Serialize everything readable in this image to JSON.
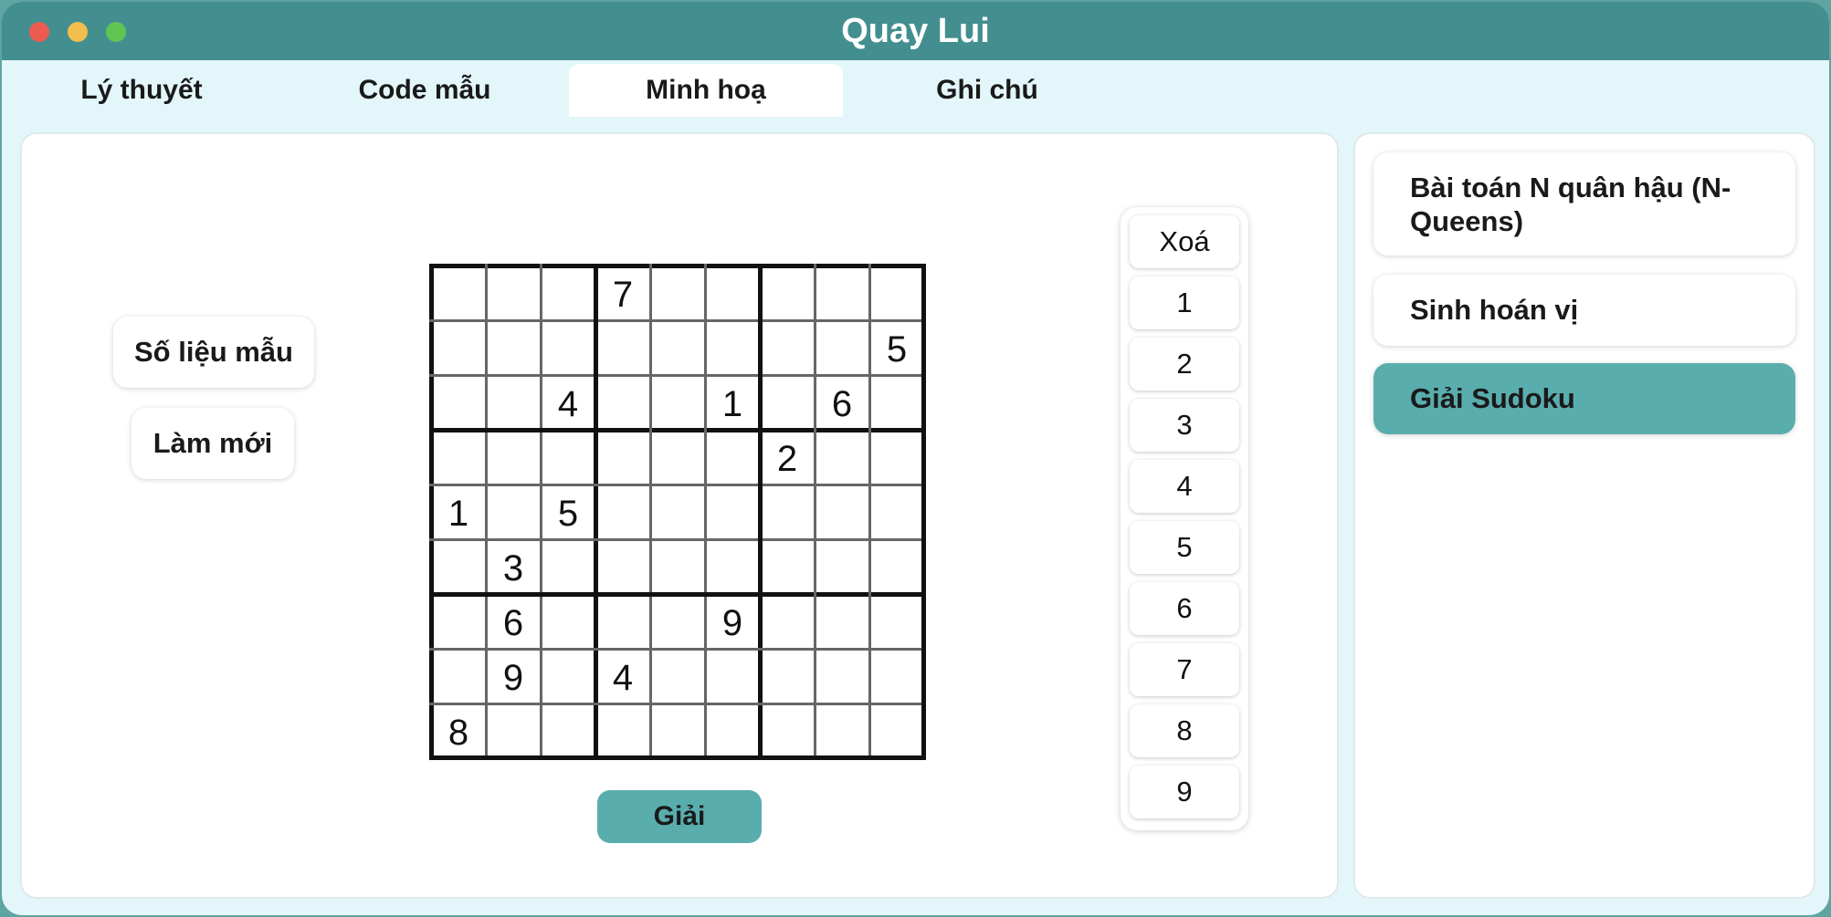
{
  "window": {
    "title": "Quay Lui",
    "controls": [
      "close",
      "minimize",
      "maximize"
    ]
  },
  "tabs": [
    {
      "label": "Lý thuyết",
      "active": false
    },
    {
      "label": "Code mẫu",
      "active": false
    },
    {
      "label": "Minh hoạ",
      "active": true
    },
    {
      "label": "Ghi chú",
      "active": false
    }
  ],
  "main": {
    "sample_button": "Số liệu mẫu",
    "reset_button": "Làm mới",
    "solve_button": "Giải",
    "sudoku": [
      [
        "",
        "",
        "",
        "7",
        "",
        "",
        "",
        "",
        ""
      ],
      [
        "",
        "",
        "",
        "",
        "",
        "",
        "",
        "",
        "5"
      ],
      [
        "",
        "",
        "4",
        "",
        "",
        "1",
        "",
        "6",
        ""
      ],
      [
        "",
        "",
        "",
        "",
        "",
        "",
        "2",
        "",
        ""
      ],
      [
        "1",
        "",
        "5",
        "",
        "",
        "",
        "",
        "",
        ""
      ],
      [
        "",
        "3",
        "",
        "",
        "",
        "",
        "",
        "",
        ""
      ],
      [
        "",
        "6",
        "",
        "",
        "",
        "9",
        "",
        "",
        ""
      ],
      [
        "",
        "9",
        "",
        "4",
        "",
        "",
        "",
        "",
        ""
      ],
      [
        "8",
        "",
        "",
        "",
        "",
        "",
        "",
        "",
        ""
      ]
    ],
    "numpad": {
      "clear_label": "Xoá",
      "digits": [
        "1",
        "2",
        "3",
        "4",
        "5",
        "6",
        "7",
        "8",
        "9"
      ]
    }
  },
  "sidebar": {
    "items": [
      {
        "label": "Bài toán N quân hậu (N-Queens)",
        "active": false
      },
      {
        "label": "Sinh hoán vị",
        "active": false
      },
      {
        "label": "Giải Sudoku",
        "active": true
      }
    ]
  },
  "colors": {
    "titlebar": "#438f8f",
    "accent": "#5aadad",
    "tabbar_bg": "#e3f6fa"
  }
}
